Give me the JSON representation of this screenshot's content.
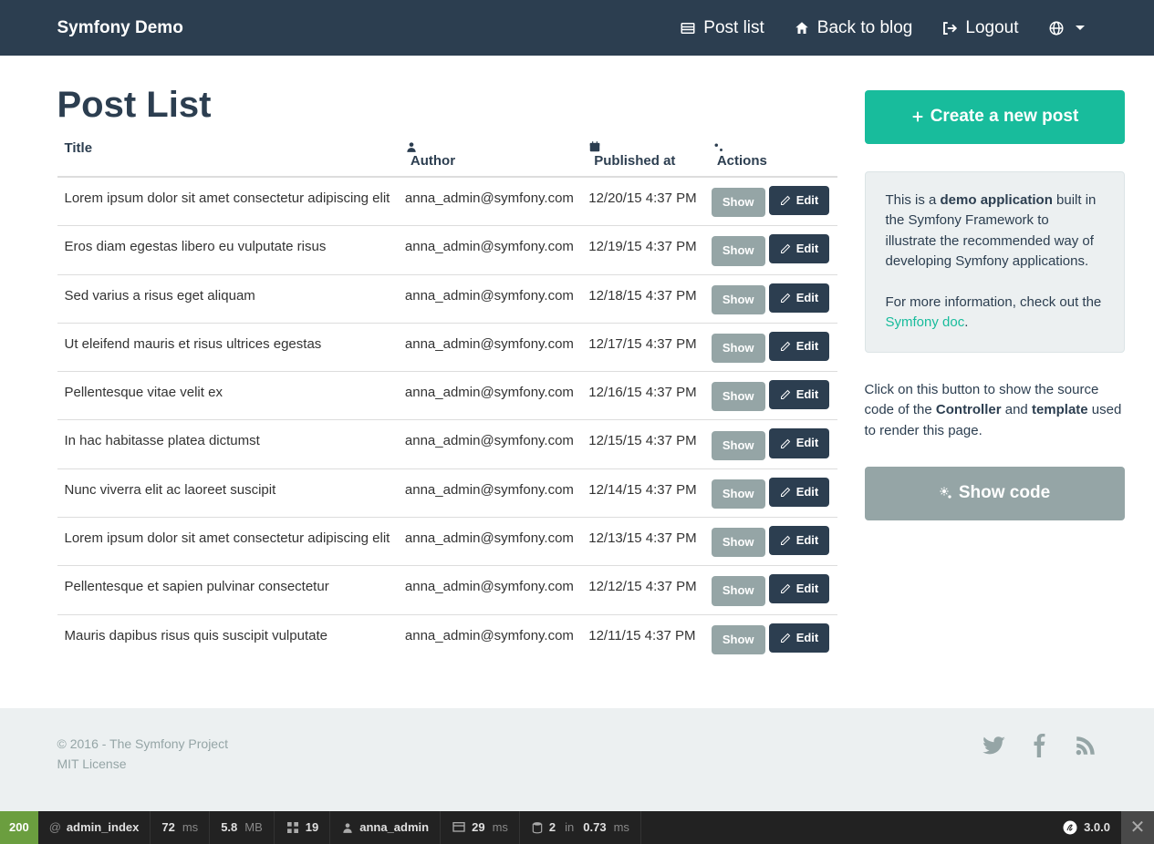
{
  "nav": {
    "brand": "Symfony Demo",
    "post_list": "Post list",
    "back_to_blog": "Back to blog",
    "logout": "Logout"
  },
  "page": {
    "title": "Post List"
  },
  "table": {
    "headers": {
      "title": "Title",
      "author": "Author",
      "published": "Published at",
      "actions": "Actions"
    },
    "show_label": "Show",
    "edit_label": "Edit",
    "rows": [
      {
        "title": "Lorem ipsum dolor sit amet consectetur adipiscing elit",
        "author": "anna_admin@symfony.com",
        "published": "12/20/15 4:37 PM"
      },
      {
        "title": "Eros diam egestas libero eu vulputate risus",
        "author": "anna_admin@symfony.com",
        "published": "12/19/15 4:37 PM"
      },
      {
        "title": "Sed varius a risus eget aliquam",
        "author": "anna_admin@symfony.com",
        "published": "12/18/15 4:37 PM"
      },
      {
        "title": "Ut eleifend mauris et risus ultrices egestas",
        "author": "anna_admin@symfony.com",
        "published": "12/17/15 4:37 PM"
      },
      {
        "title": "Pellentesque vitae velit ex",
        "author": "anna_admin@symfony.com",
        "published": "12/16/15 4:37 PM"
      },
      {
        "title": "In hac habitasse platea dictumst",
        "author": "anna_admin@symfony.com",
        "published": "12/15/15 4:37 PM"
      },
      {
        "title": "Nunc viverra elit ac laoreet suscipit",
        "author": "anna_admin@symfony.com",
        "published": "12/14/15 4:37 PM"
      },
      {
        "title": "Lorem ipsum dolor sit amet consectetur adipiscing elit",
        "author": "anna_admin@symfony.com",
        "published": "12/13/15 4:37 PM"
      },
      {
        "title": "Pellentesque et sapien pulvinar consectetur",
        "author": "anna_admin@symfony.com",
        "published": "12/12/15 4:37 PM"
      },
      {
        "title": "Mauris dapibus risus quis suscipit vulputate",
        "author": "anna_admin@symfony.com",
        "published": "12/11/15 4:37 PM"
      }
    ]
  },
  "sidebar": {
    "create_label": "Create a new post",
    "well_p1_a": "This is a ",
    "well_p1_b": "demo application",
    "well_p1_c": " built in the Symfony Framework to illustrate the recommended way of developing Symfony applications.",
    "well_p2_a": "For more information, check out the ",
    "well_p2_link": "Symfony doc",
    "well_p2_b": ".",
    "side_a": "Click on this button to show the source code of the ",
    "side_b": "Controller",
    "side_c": " and ",
    "side_d": "template",
    "side_e": " used to render this page.",
    "showcode_label": "Show code"
  },
  "footer": {
    "copyright": "© 2016 - The Symfony Project",
    "license": "MIT License"
  },
  "debug": {
    "status": "200",
    "route_at": "@",
    "route": "admin_index",
    "time": "72",
    "time_unit": "ms",
    "mem": "5.8",
    "mem_unit": "MB",
    "forms": "19",
    "user": "anna_admin",
    "render": "29",
    "render_unit": "ms",
    "db_a": "2",
    "db_in": "in",
    "db_b": "0.73",
    "db_unit": "ms",
    "version": "3.0.0"
  }
}
